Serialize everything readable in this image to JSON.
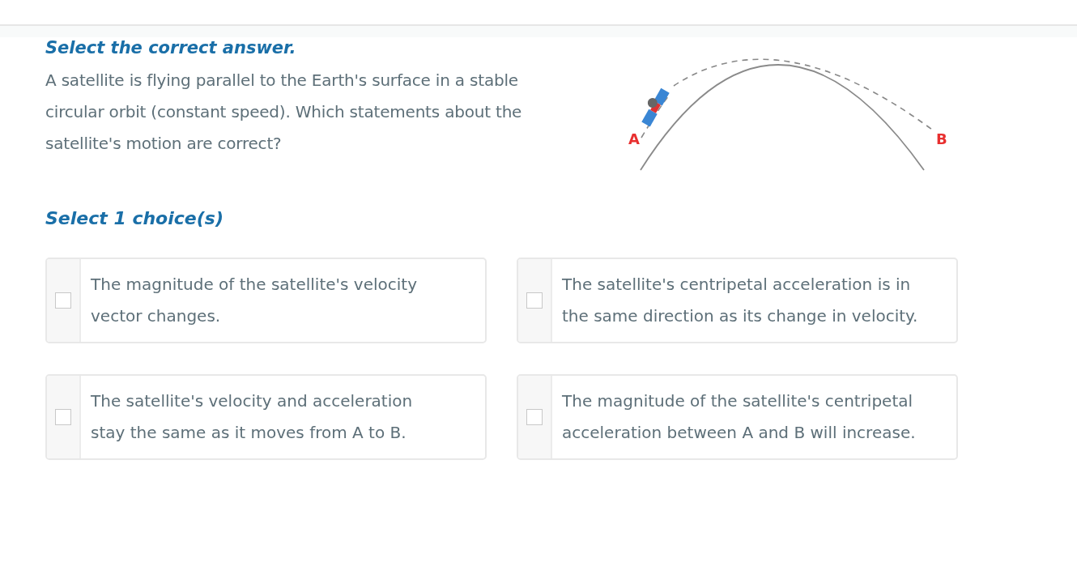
{
  "instruction": "Select the correct answer.",
  "question": "A satellite is flying parallel to the Earth's surface in a stable circular orbit (constant speed). Which statements about the satellite's motion are correct?",
  "diagram": {
    "point_labels": [
      "A",
      "B"
    ]
  },
  "choice_prompt": "Select 1 choice(s)",
  "choices": [
    {
      "text": "The magnitude of the satellite's velocity vector changes.",
      "checked": false
    },
    {
      "text": "The satellite's centripetal acceleration is in the same direction as its change in velocity.",
      "checked": false
    },
    {
      "text": "The satellite's velocity and acceleration stay the same as it moves from A to B.",
      "checked": false
    },
    {
      "text": "The magnitude of the satellite's centripetal acceleration between A and B will increase.",
      "checked": false
    }
  ]
}
